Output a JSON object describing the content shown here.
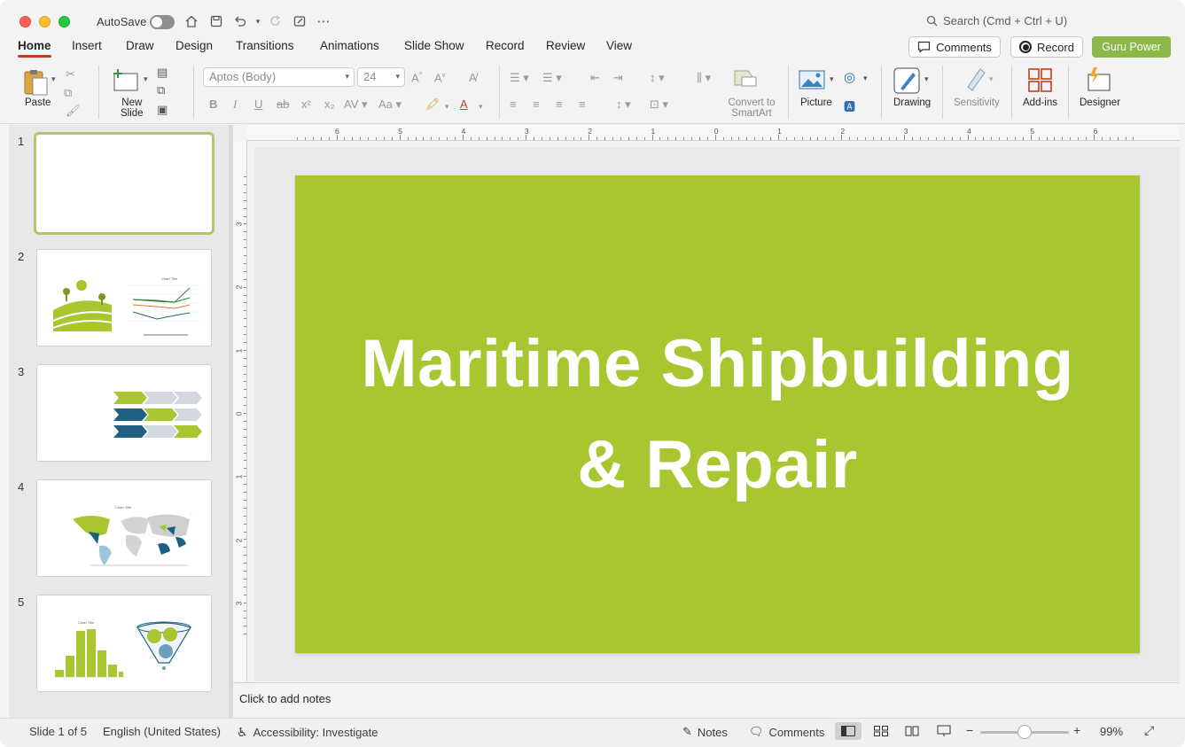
{
  "titlebar": {
    "autosave_label": "AutoSave",
    "search_placeholder": "Search (Cmd + Ctrl + U)"
  },
  "tabs": [
    "Home",
    "Insert",
    "Draw",
    "Design",
    "Transitions",
    "Animations",
    "Slide Show",
    "Record",
    "Review",
    "View"
  ],
  "active_tab": "Home",
  "header_buttons": {
    "comments": "Comments",
    "record": "Record",
    "guru": "Guru Power"
  },
  "ribbon": {
    "paste": "Paste",
    "new_slide_line1": "New",
    "new_slide_line2": "Slide",
    "font_name": "Aptos (Body)",
    "font_size": "24",
    "convert_line1": "Convert to",
    "convert_line2": "SmartArt",
    "picture": "Picture",
    "drawing": "Drawing",
    "sensitivity": "Sensitivity",
    "addins": "Add-ins",
    "designer": "Designer"
  },
  "thumbnails": [
    {
      "num": "1"
    },
    {
      "num": "2"
    },
    {
      "num": "3"
    },
    {
      "num": "4"
    },
    {
      "num": "5"
    }
  ],
  "slide": {
    "title_line1": "Maritime Shipbuilding",
    "title_line2": "& Repair",
    "background_color": "#a7c62f"
  },
  "notes_placeholder": "Click to add notes",
  "status": {
    "slide_indicator": "Slide 1 of 5",
    "language": "English (United States)",
    "accessibility": "Accessibility: Investigate",
    "notes": "Notes",
    "comments": "Comments",
    "zoom": "99%"
  },
  "ruler": {
    "h_labels": [
      "6",
      "5",
      "4",
      "3",
      "2",
      "1",
      "0",
      "1",
      "2",
      "3",
      "4",
      "5",
      "6"
    ],
    "v_labels": [
      "3",
      "2",
      "1",
      "0",
      "1",
      "2",
      "3"
    ]
  }
}
